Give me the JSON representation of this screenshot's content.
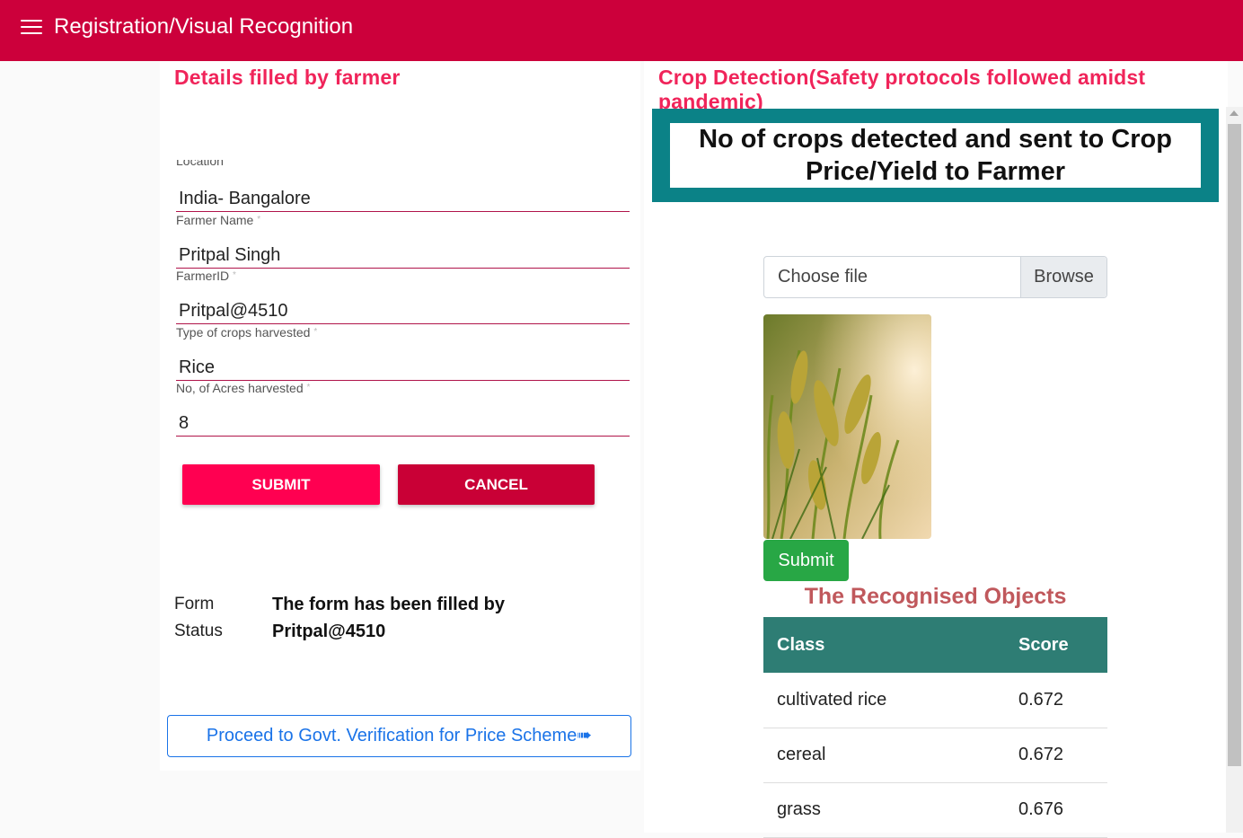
{
  "header": {
    "title": "Registration/Visual Recognition"
  },
  "farmer_form": {
    "title": "Details filled by farmer",
    "location_label": "Location",
    "location_value": "India- Bangalore",
    "fields": [
      {
        "label": "Farmer Name",
        "value": "Pritpal Singh"
      },
      {
        "label": "FarmerID",
        "value": "Pritpal@4510"
      },
      {
        "label": "Type of crops harvested",
        "value": "Rice"
      },
      {
        "label": "No, of Acres harvested",
        "value": "8"
      }
    ],
    "required_mark": "*",
    "submit_label": "SUBMIT",
    "cancel_label": "CANCEL",
    "status_label_1": "Form",
    "status_label_2": "Status",
    "status_text": "The form has been filled by Pritpal@4510",
    "proceed_label": "Proceed to Govt. Verification for Price Scheme➠"
  },
  "detection": {
    "title": "Crop Detection(Safety protocols followed amidst pandemic)",
    "banner_text": "No of crops detected and sent to Crop Price/Yield to Farmer",
    "file_placeholder": "Choose file",
    "browse_label": "Browse",
    "submit_label": "Submit",
    "results_title": "The Recognised Objects",
    "table_headers": [
      "Class",
      "Score"
    ],
    "results": [
      {
        "class": "cultivated rice",
        "score": "0.672"
      },
      {
        "class": "cereal",
        "score": "0.672"
      },
      {
        "class": "grass",
        "score": "0.676"
      }
    ]
  },
  "colors": {
    "header_bg": "#cc003b",
    "accent_pink": "#f0245a",
    "banner_teal": "#0b8287",
    "table_header": "#2e7d74",
    "submit_green": "#28a745"
  }
}
